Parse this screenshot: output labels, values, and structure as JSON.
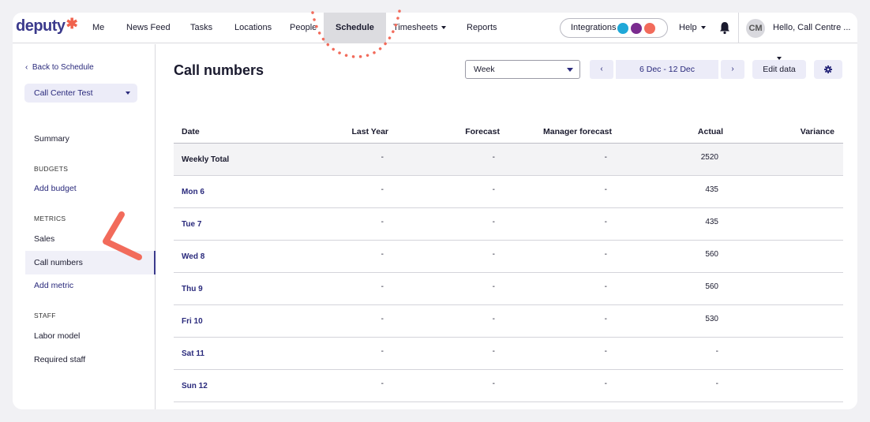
{
  "nav": {
    "logo": "deputy",
    "items": [
      "Me",
      "News Feed",
      "Tasks",
      "Locations",
      "People",
      "Schedule",
      "Timesheets",
      "Reports"
    ],
    "active": "Schedule",
    "integrations_label": "Integrations",
    "help_label": "Help",
    "avatar_initials": "CM",
    "greeting": "Hello, Call Centre ..."
  },
  "sidebar": {
    "back_label": "Back to Schedule",
    "location_select": "Call Center Test",
    "summary": "Summary",
    "budgets_heading": "BUDGETS",
    "add_budget": "Add budget",
    "metrics_heading": "METRICS",
    "sales": "Sales",
    "call_numbers": "Call numbers",
    "add_metric": "Add metric",
    "staff_heading": "STAFF",
    "labor_model": "Labor model",
    "required_staff": "Required staff"
  },
  "main": {
    "title": "Call numbers",
    "period_select": "Week",
    "date_range": "6 Dec - 12 Dec",
    "prev_label": "‹",
    "next_label": "›",
    "edit_label": "Edit data"
  },
  "table": {
    "columns": [
      "Date",
      "Last Year",
      "Forecast",
      "Manager forecast",
      "Actual",
      "Variance"
    ],
    "rows": [
      {
        "date": "Weekly Total",
        "last_year": "-",
        "forecast": "-",
        "manager_forecast": "-",
        "actual": "2520",
        "variance": ""
      },
      {
        "date": "Mon 6",
        "last_year": "-",
        "forecast": "-",
        "manager_forecast": "-",
        "actual": "435",
        "variance": ""
      },
      {
        "date": "Tue 7",
        "last_year": "-",
        "forecast": "-",
        "manager_forecast": "-",
        "actual": "435",
        "variance": ""
      },
      {
        "date": "Wed 8",
        "last_year": "-",
        "forecast": "-",
        "manager_forecast": "-",
        "actual": "560",
        "variance": ""
      },
      {
        "date": "Thu 9",
        "last_year": "-",
        "forecast": "-",
        "manager_forecast": "-",
        "actual": "560",
        "variance": ""
      },
      {
        "date": "Fri 10",
        "last_year": "-",
        "forecast": "-",
        "manager_forecast": "-",
        "actual": "530",
        "variance": ""
      },
      {
        "date": "Sat 11",
        "last_year": "-",
        "forecast": "-",
        "manager_forecast": "-",
        "actual": "-",
        "variance": ""
      },
      {
        "date": "Sun 12",
        "last_year": "-",
        "forecast": "-",
        "manager_forecast": "-",
        "actual": "-",
        "variance": ""
      }
    ]
  },
  "colors": {
    "brand": "#3b3a8c",
    "accent": "#f0624d",
    "link": "#2a2a7c",
    "annotation": "#f26b5b"
  }
}
